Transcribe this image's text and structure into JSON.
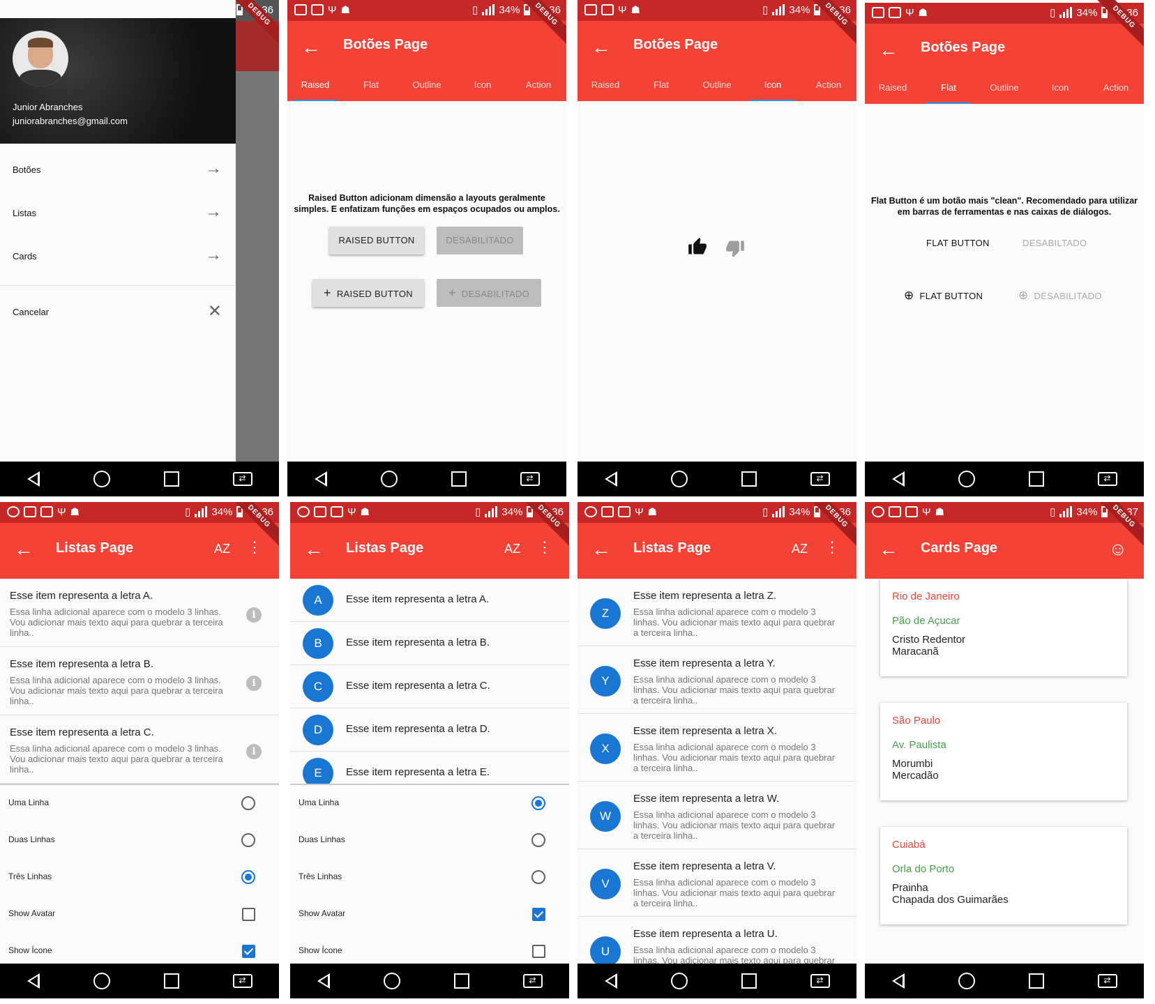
{
  "status": {
    "battery": "34%",
    "time1": "13:36",
    "time2": "13:37",
    "debug": "DEBUG"
  },
  "drawer": {
    "name": "Junior Abranches",
    "email": "juniorabranches@gmail.com",
    "items": [
      {
        "label": "Botões",
        "icon": "arrow-right-icon"
      },
      {
        "label": "Listas",
        "icon": "arrow-right-icon"
      },
      {
        "label": "Cards",
        "icon": "arrow-right-icon"
      }
    ],
    "cancel": "Cancelar"
  },
  "botoes": {
    "title": "Botões Page",
    "tabs": [
      "Raised",
      "Flat",
      "Outline",
      "Icon",
      "Action"
    ],
    "raised_desc": "Raised Button adicionam dimensão a layouts geralmente simples. E enfatizam funções em espaços ocupados ou amplos.",
    "raised_btn": "RAISED BUTTON",
    "disabled": "DESABILITADO",
    "flat_desc": "Flat Button é um botão mais \"clean\". Recomendado para utilizar em barras de ferramentas e nas caixas de diálogos.",
    "flat_btn": "FLAT BUTTON",
    "flat_disabled": "DESABILTADO",
    "flat_disabled2": "DESABILITADO"
  },
  "listas": {
    "title": "Listas Page",
    "sort_icon": "AZ",
    "items": [
      {
        "letter": "A",
        "title": "Esse item representa a letra A."
      },
      {
        "letter": "B",
        "title": "Esse item representa a letra B."
      },
      {
        "letter": "C",
        "title": "Esse item representa a letra C."
      },
      {
        "letter": "D",
        "title": "Esse item representa a letra D."
      },
      {
        "letter": "E",
        "title": "Esse item representa a letra E."
      }
    ],
    "rev_items": [
      {
        "letter": "Z",
        "title": "Esse item representa a letra Z."
      },
      {
        "letter": "Y",
        "title": "Esse item representa a letra Y."
      },
      {
        "letter": "X",
        "title": "Esse item representa a letra X."
      },
      {
        "letter": "W",
        "title": "Esse item representa a letra W."
      },
      {
        "letter": "V",
        "title": "Esse item representa a letra V."
      },
      {
        "letter": "U",
        "title": "Esse item representa a letra U."
      }
    ],
    "subtitle": "Essa linha adicional aparece com o modelo 3 linhas. Vou adicionar mais texto aqui para quebrar a terceira linha..",
    "subtitle_cut": "a terceira linha..",
    "options": [
      "Uma Linha",
      "Duas Linhas",
      "Três Linhas",
      "Show Avatar",
      "Show Ícone"
    ]
  },
  "cards": {
    "title": "Cards Page",
    "items": [
      {
        "a": "Rio de Janeiro",
        "b": "Pão de Açucar",
        "c": "Cristo Redentor",
        "d": "Maracanã"
      },
      {
        "a": "São Paulo",
        "b": "Av. Paulista",
        "c": "Morumbi",
        "d": "Mercadão"
      },
      {
        "a": "Cuiabá",
        "b": "Orla do Porto",
        "c": "Prainha",
        "d": "Chapada dos Guimarães"
      }
    ]
  },
  "colors": {
    "accent": "#f44336",
    "blue": "#1976d2",
    "green": "#43a047"
  }
}
